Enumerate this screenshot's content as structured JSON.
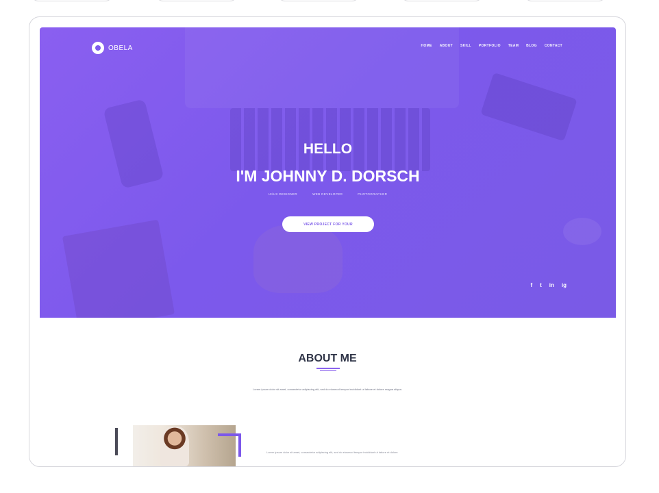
{
  "site": {
    "brand": "OBELA",
    "nav": [
      "HOME",
      "ABOUT",
      "SKILL",
      "PORTFOLIO",
      "TEAM",
      "BLOG",
      "CONTACT"
    ]
  },
  "hero": {
    "greeting": "HELLO",
    "headline": "I'M JOHNNY D. DORSCH",
    "roles": [
      "UI/UX DESIGNER",
      "WEB DEVELOPER",
      "PHOTOGRAPHER"
    ],
    "cta_label": "VIEW PROJECT FOR YOUR"
  },
  "social": [
    "f",
    "t",
    "in",
    "ig"
  ],
  "about": {
    "title": "ABOUT ME",
    "intro": "Lorem ipsum dolor sit amet, consectetur adipiscing elit, sed do eiusmod tempor incididunt ut labore et dolore magna aliqua.",
    "paragraph": "Lorem ipsum dolor sit amet, consectetur adipiscing elit, sed do eiusmod tempor incididunt ut labore et dolore"
  },
  "colors": {
    "accent": "#7f5bee",
    "heading": "#2f3447"
  },
  "icons": {
    "brand": "brand-logo-icon",
    "facebook": "facebook-icon",
    "twitter": "twitter-icon",
    "linkedin": "linkedin-icon",
    "instagram": "instagram-icon"
  }
}
